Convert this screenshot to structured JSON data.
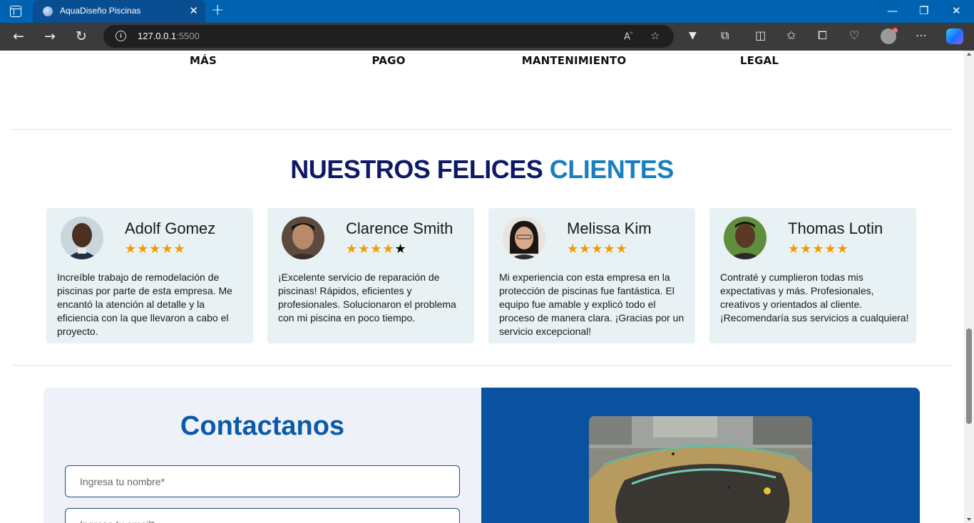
{
  "browser": {
    "tab_title": "AquaDiseño Piscinas",
    "tab_close": "✕",
    "new_tab": "+",
    "address_host": "127.0.0.1",
    "address_port": ":5500",
    "window": {
      "minimize": "—",
      "maximize": "❐",
      "close": "✕"
    },
    "nav": {
      "back": "←",
      "forward": "→",
      "reload": "↻"
    }
  },
  "services": {
    "labels": [
      "MÁS",
      "PAGO",
      "MANTENIMIENTO",
      "LEGAL"
    ]
  },
  "testimonials": {
    "title": "NUESTROS FELICES",
    "title_highlight": "CLIENTES",
    "cards": [
      {
        "name": "Adolf Gomez",
        "rating": 5,
        "text": "Increíble trabajo de remodelación de piscinas por parte de esta empresa. Me encantó la atención al detalle y la eficiencia con la que llevaron a cabo el proyecto."
      },
      {
        "name": "Clarence Smith",
        "rating": 4,
        "text": "¡Excelente servicio de reparación de piscinas! Rápidos, eficientes y profesionales. Solucionaron el problema con mi piscina en poco tiempo."
      },
      {
        "name": "Melissa Kim",
        "rating": 5,
        "text": "Mi experiencia con esta empresa en la protección de piscinas fue fantástica. El equipo fue amable y explicó todo el proceso de manera clara. ¡Gracias por un servicio excepcional!"
      },
      {
        "name": "Thomas Lotin",
        "rating": 5,
        "text": "Contraté y cumplieron todas mis expectativas y más. Profesionales, creativos y orientados al cliente. ¡Recomendaría sus servicios a cualquiera!"
      }
    ]
  },
  "contact": {
    "title": "Contactanos",
    "name_placeholder": "Ingresa tu nombre*",
    "email_placeholder": "Ingresa tu email*"
  },
  "colors": {
    "title_dark": "#0f1a66",
    "title_accent": "#1a7fc0",
    "star": "#f59a00",
    "contact_panel": "#0a52a0"
  }
}
